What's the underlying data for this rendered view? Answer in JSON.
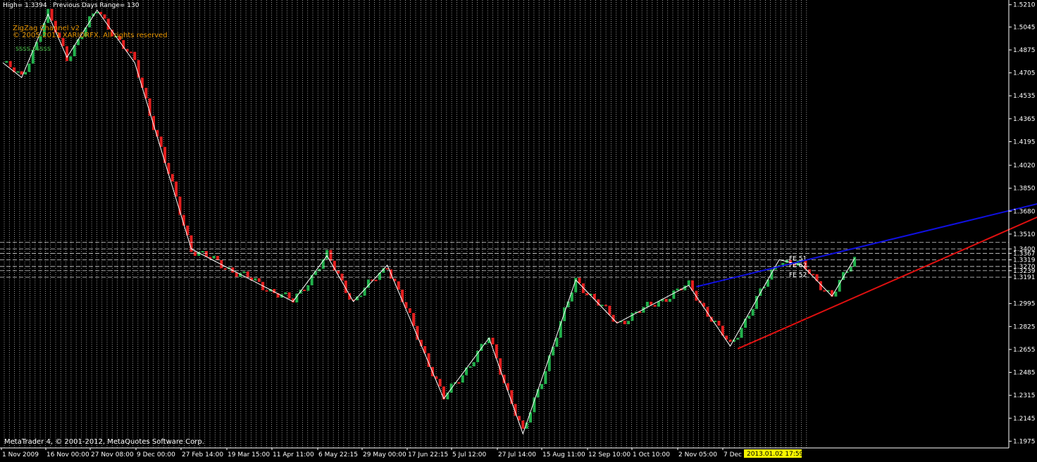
{
  "header": {
    "info_text": "High= 1.3394   Previous Days Range= 130",
    "indicator_name": "ZigZag Channel v2",
    "indicator_copyright": "© 2005-2011 XARIORFX. All rights reserved",
    "indicator_note": "ssss.sssss"
  },
  "footer": {
    "copyright": "MetaTrader 4, © 2001-2012, MetaQuotes Software Corp.",
    "current_time_label": "2013.01.02 17:59"
  },
  "colors": {
    "background": "#000000",
    "bull_bar": "#22b14c",
    "bear_bar": "#e41e1e",
    "zigzag": "#ffffff",
    "upper_channel": "#1010e0",
    "lower_channel": "#e01010",
    "grid": "#ffffff",
    "time_badge": "#f5f500",
    "info_text": "#ffffff",
    "indicator_text": "#e69500",
    "note_text": "#3fae3f"
  },
  "chart_data": {
    "type": "line",
    "title": "",
    "ylim": [
      1.1925,
      1.5245
    ],
    "y_ticks": [
      "1.5210",
      "1.5045",
      "1.4875",
      "1.4705",
      "1.4535",
      "1.4365",
      "1.4195",
      "1.4020",
      "1.3850",
      "1.3680",
      "1.3510",
      "1.3400",
      "1.3367",
      "1.3319",
      "1.3270",
      "1.3239",
      "1.3191",
      "1.2995",
      "1.2825",
      "1.2655",
      "1.2485",
      "1.2315",
      "1.2145",
      "1.1975"
    ],
    "x_ticks": [
      "1 Nov 2009",
      "16 Nov 00:00",
      "27 Nov 08:00",
      "9 Dec 00:00",
      "27 Feb 14:00",
      "19 Mar 15:00",
      "11 Apr 11:00",
      "6 May 22:15",
      "29 May 00:00",
      "17 Jun 22:15",
      "5 Jul 12:00",
      "27 Jul 14:00",
      "15 Aug 11:00",
      "12 Sep 10:00",
      "1 Oct 10:00",
      "2 Nov 05:00",
      "7 Dec"
    ],
    "fib_labels": [
      "FE 51",
      "FE 62",
      "FE 52"
    ],
    "series": [
      {
        "kind": "zigzag",
        "x": [
          0,
          5,
          12,
          17,
          25,
          35,
          50,
          77,
          86,
          93,
          102,
          117,
          129,
          138,
          152,
          163,
          182,
          193,
          206,
          212,
          220,
          226
        ],
        "values": [
          1.478,
          1.467,
          1.514,
          1.482,
          1.517,
          1.478,
          1.34,
          1.301,
          1.335,
          1.301,
          1.328,
          1.229,
          1.274,
          1.203,
          1.317,
          1.285,
          1.313,
          1.268,
          1.332,
          1.328,
          1.305,
          1.333
        ]
      },
      {
        "kind": "upper_channel",
        "x": [
          184,
          296
        ],
        "values": [
          1.312,
          1.388
        ]
      },
      {
        "kind": "lower_channel",
        "x": [
          195,
          296
        ],
        "values": [
          1.266,
          1.39
        ]
      }
    ]
  }
}
